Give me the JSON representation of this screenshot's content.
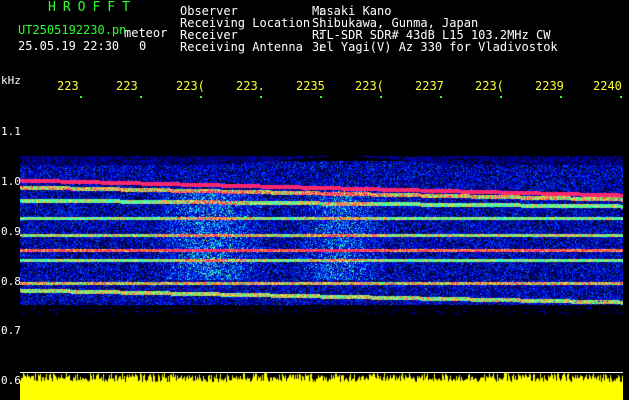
{
  "header": {
    "app_title": "HROFFT",
    "file_name": "UT2505192230.pn",
    "file_type": "meteor",
    "datetime": "25.05.19 22:30",
    "count": "0",
    "info_labels": "Observer           : \nReceiving Location : \nReceiver           : \nReceiving Antenna  : ",
    "info_values": "Masaki Kano\nShibukawa, Gunma, Japan\nRTL-SDR SDR# 43dB L15 103.2MHz CW\n3el Yagi(V) Az 330 for Vladivostok"
  },
  "axes": {
    "y_unit": "kHz",
    "y_ticks": [
      "1.1",
      "1.0",
      "0.9",
      "0.8",
      "0.7",
      "0.6"
    ],
    "x_ticks": [
      "223",
      "223",
      "223(",
      "223.",
      "2235",
      "223(",
      "2237",
      "223(",
      "2239",
      "2240"
    ]
  },
  "colors": {
    "background": "#000000",
    "label_green": "#2bff2b",
    "axis_yellow": "#ffff33",
    "signal_low": "#0000a0",
    "signal_mid": "#00ffc0",
    "signal_high": "#ff3060",
    "power_bar": "#ffff00"
  }
}
